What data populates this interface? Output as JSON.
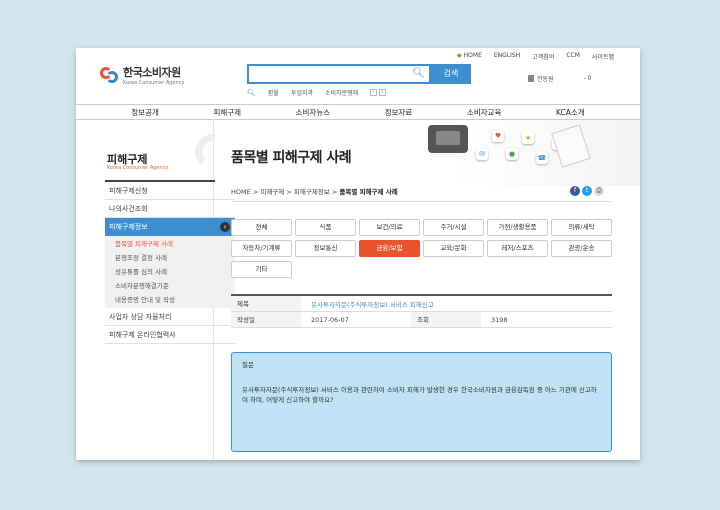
{
  "top_nav": [
    "HOME",
    "ENGLISH",
    "고객참여",
    "CCM",
    "사이트맵"
  ],
  "logo": {
    "korean": "한국소비자원",
    "english": "Korea Consumer Agency"
  },
  "search": {
    "value": "",
    "button": "검색"
  },
  "keywords": [
    "환불",
    "투업지과",
    "소비자분쟁해"
  ],
  "user_panel": {
    "location": "전동원",
    "temp": "- 0"
  },
  "gnb": [
    "정보공개",
    "피해구제",
    "소비자뉴스",
    "정보자료",
    "소비자교육",
    "KCA소개"
  ],
  "sidebar": {
    "title": "피해구제",
    "subtitle": "Korea Consumer Agency",
    "items_top": [
      "피해구제신청",
      "나의사건조회"
    ],
    "active": "피해구제정보",
    "subitems": [
      "품목별 피해구제 사례",
      "분쟁조정 결정 사례",
      "성유튜롤 심의 사례",
      "소비자분쟁해결기준",
      "내용증명 안내 및 작성"
    ],
    "items_bottom": [
      "사업자 상담 자율처리",
      "피해구제 온라인협력사"
    ]
  },
  "page_title": "품목별 피해구제 사례",
  "breadcrumb": {
    "home": "HOME",
    "l1": "피해구제",
    "l2": "피해구제정보",
    "current": "품목별 피해구제 사례",
    "sep": ">"
  },
  "categories": [
    "전체",
    "식품",
    "보건/의료",
    "주거/시설",
    "가전/생활용품",
    "의류/세탁",
    "자동차/기계류",
    "정보통신",
    "금융/보험",
    "교육/문화",
    "레저/스포츠",
    "관광/운송",
    "기타"
  ],
  "active_category": "금융/보험",
  "info": {
    "title_label": "제목",
    "title_value": "유사투자자문(주식투자정보) 서비스 피해신고",
    "date_label": "작성일",
    "date_value": "2017-06-07",
    "views_label": "조회",
    "views_value": "3198"
  },
  "question": {
    "label": "질문",
    "text": "유사투자자문(주식투자정보) 서비스 이용과 관련하여 소비자 피해가 발생한 경우 한국소비자원과 금융감독원 중 어느 기관에 신고하여 하며, 어떻게 신고하야 할까요?"
  }
}
